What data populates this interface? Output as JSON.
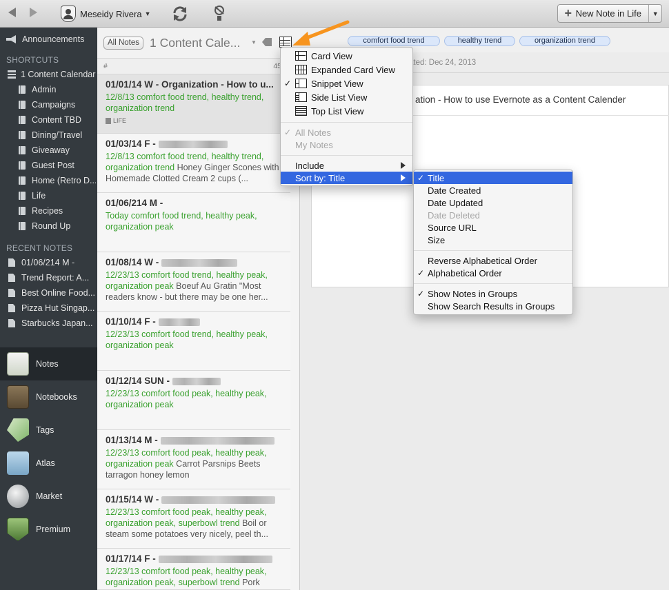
{
  "toolbar": {
    "account_name": "Meseidy Rivera",
    "new_note_label": "New Note in Life"
  },
  "sidebar": {
    "announcements": "Announcements",
    "shortcuts_heading": "SHORTCUTS",
    "shortcuts": [
      {
        "label": "1 Content Calendar",
        "icon": "notebook-stack-icon"
      },
      {
        "label": "Admin",
        "icon": "notebook-icon"
      },
      {
        "label": "Campaigns",
        "icon": "notebook-icon"
      },
      {
        "label": "Content TBD",
        "icon": "notebook-icon"
      },
      {
        "label": "Dining/Travel",
        "icon": "notebook-icon"
      },
      {
        "label": "Giveaway",
        "icon": "notebook-icon"
      },
      {
        "label": "Guest Post",
        "icon": "notebook-icon"
      },
      {
        "label": "Home (Retro D...",
        "icon": "notebook-icon"
      },
      {
        "label": "Life",
        "icon": "notebook-icon"
      },
      {
        "label": "Recipes",
        "icon": "notebook-icon"
      },
      {
        "label": "Round Up",
        "icon": "notebook-icon"
      }
    ],
    "recent_heading": "RECENT NOTES",
    "recent": [
      "01/06/214 M -",
      "Trend Report: A...",
      "Best Online Food...",
      "Pizza Hut Singap...",
      "Starbucks Japan..."
    ],
    "nav": [
      {
        "label": "Notes",
        "icon": "notes-icon",
        "active": true
      },
      {
        "label": "Notebooks",
        "icon": "notebooks-icon"
      },
      {
        "label": "Tags",
        "icon": "tags-icon"
      },
      {
        "label": "Atlas",
        "icon": "atlas-icon"
      },
      {
        "label": "Market",
        "icon": "market-icon"
      },
      {
        "label": "Premium",
        "icon": "premium-icon"
      }
    ]
  },
  "notelist": {
    "scope_pill": "All Notes",
    "title": "1 Content Cale...",
    "col_hash": "#",
    "col_count": "45",
    "notes": [
      {
        "title": "01/01/14 W - Organization - How to u...",
        "date": "12/8/13",
        "tags": "comfort food trend, healthy trend, organization trend",
        "snippet": "",
        "notebook_tag": "LIFE"
      },
      {
        "title": "01/03/14  F -",
        "date": "12/8/13",
        "tags": "comfort food trend, healthy trend, organization trend",
        "snippet": "Honey Ginger Scones with Homemade Clotted Cream 2 cups (..."
      },
      {
        "title": "01/06/214 M -",
        "date": "Today",
        "tags": "comfort food trend, healthy peak, organization peak",
        "snippet": ""
      },
      {
        "title": "01/08/14 W -",
        "date": "12/23/13",
        "tags": "comfort food trend, healthy peak, organization peak",
        "snippet": "Boeuf Au Gratin \"Most readers know - but there may be one her..."
      },
      {
        "title": "01/10/14 F -",
        "date": "12/23/13",
        "tags": "comfort food trend, healthy peak, organization peak",
        "snippet": ""
      },
      {
        "title": "01/12/14 SUN -",
        "date": "12/23/13",
        "tags": "comfort food peak, healthy peak, organization peak",
        "snippet": ""
      },
      {
        "title": "01/13/14 M -",
        "date": "12/23/13",
        "tags": "comfort food peak, healthy peak, organization peak",
        "snippet": "Carrot Parsnips Beets tarragon honey lemon"
      },
      {
        "title": "01/15/14 W -",
        "date": "12/23/13",
        "tags": "comfort food peak, healthy peak, organization peak, superbowl trend",
        "snippet": "Boil or steam some potatoes very nicely, peel th..."
      },
      {
        "title": "01/17/14 F -",
        "date": "12/23/13",
        "tags": "comfort food peak, healthy peak, organization peak, superbowl trend",
        "snippet": "Pork"
      }
    ]
  },
  "editor": {
    "tags": [
      "comfort food trend",
      "healthy trend",
      "organization trend"
    ],
    "updated": "ated: Dec 24, 2013",
    "note_title": "ation - How to use Evernote as a Content Calender"
  },
  "view_menu": {
    "views": [
      {
        "label": "Card View",
        "glyph": "card-view-icon",
        "checked": false
      },
      {
        "label": "Expanded Card View",
        "glyph": "expanded-card-view-icon",
        "checked": false
      },
      {
        "label": "Snippet View",
        "glyph": "snippet-view-icon",
        "checked": true
      },
      {
        "label": "Side List View",
        "glyph": "side-list-view-icon",
        "checked": false
      },
      {
        "label": "Top List View",
        "glyph": "top-list-view-icon",
        "checked": false
      }
    ],
    "scope": [
      {
        "label": "All Notes",
        "checked": true
      },
      {
        "label": "My Notes",
        "checked": false
      }
    ],
    "include": "Include",
    "sort_by": "Sort by: Title"
  },
  "sort_menu": {
    "fields": [
      {
        "label": "Title",
        "checked": true,
        "disabled": false
      },
      {
        "label": "Date Created",
        "checked": false,
        "disabled": false
      },
      {
        "label": "Date Updated",
        "checked": false,
        "disabled": false
      },
      {
        "label": "Date Deleted",
        "checked": false,
        "disabled": true
      },
      {
        "label": "Source URL",
        "checked": false,
        "disabled": false
      },
      {
        "label": "Size",
        "checked": false,
        "disabled": false
      }
    ],
    "order": [
      {
        "label": "Reverse Alphabetical Order",
        "checked": false
      },
      {
        "label": "Alphabetical Order",
        "checked": true
      }
    ],
    "grouping": [
      {
        "label": "Show Notes in Groups",
        "checked": true
      },
      {
        "label": "Show Search Results in Groups",
        "checked": false
      }
    ]
  },
  "colors": {
    "sidebar_bg": "#343a3f",
    "tag_green": "#3aa12f",
    "menu_highlight": "#3367e0",
    "callout_orange": "#f7941e"
  }
}
